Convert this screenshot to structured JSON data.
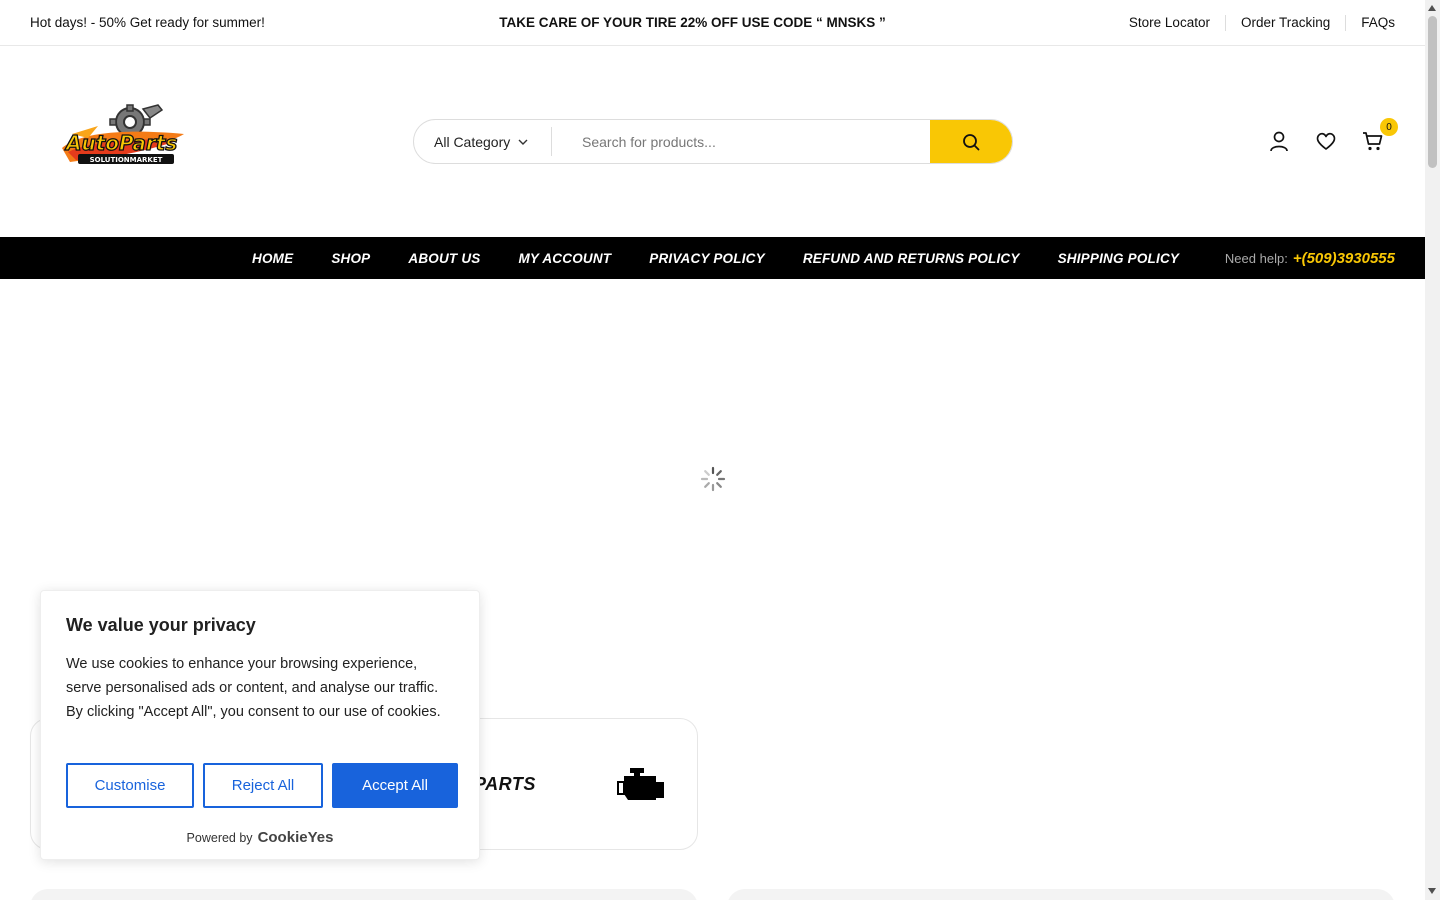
{
  "topbar": {
    "promo_left": "Hot days! - 50% Get ready for summer!",
    "promo_center": "TAKE CARE OF YOUR TIRE 22% OFF USE CODE “ MNSKS ”",
    "links": [
      "Store Locator",
      "Order Tracking",
      "FAQs"
    ]
  },
  "header": {
    "logo_text": "AutoParts",
    "logo_subtext": "SOLUTIONMARKET",
    "category_label": "All Category",
    "search_placeholder": "Search for products...",
    "cart_count": "0"
  },
  "nav": {
    "items": [
      "HOME",
      "SHOP",
      "ABOUT US",
      "MY ACCOUNT",
      "PRIVACY POLICY",
      "REFUND AND RETURNS POLICY",
      "SHIPPING POLICY"
    ],
    "help_label": "Need help:",
    "help_phone": "+(509)3930555"
  },
  "content": {
    "brand_text": "PARTS"
  },
  "cookie": {
    "title": "We value your privacy",
    "body": "We use cookies to enhance your browsing experience, serve personalised ads or content, and analyse our traffic. By clicking \"Accept All\", you consent to our use of cookies.",
    "customise": "Customise",
    "reject": "Reject All",
    "accept": "Accept All",
    "powered_by": "Powered by",
    "powered_brand": "CookieYes"
  },
  "colors": {
    "accent": "#f9c705",
    "cookie_blue": "#1863dc",
    "nav_bg": "#000000"
  }
}
